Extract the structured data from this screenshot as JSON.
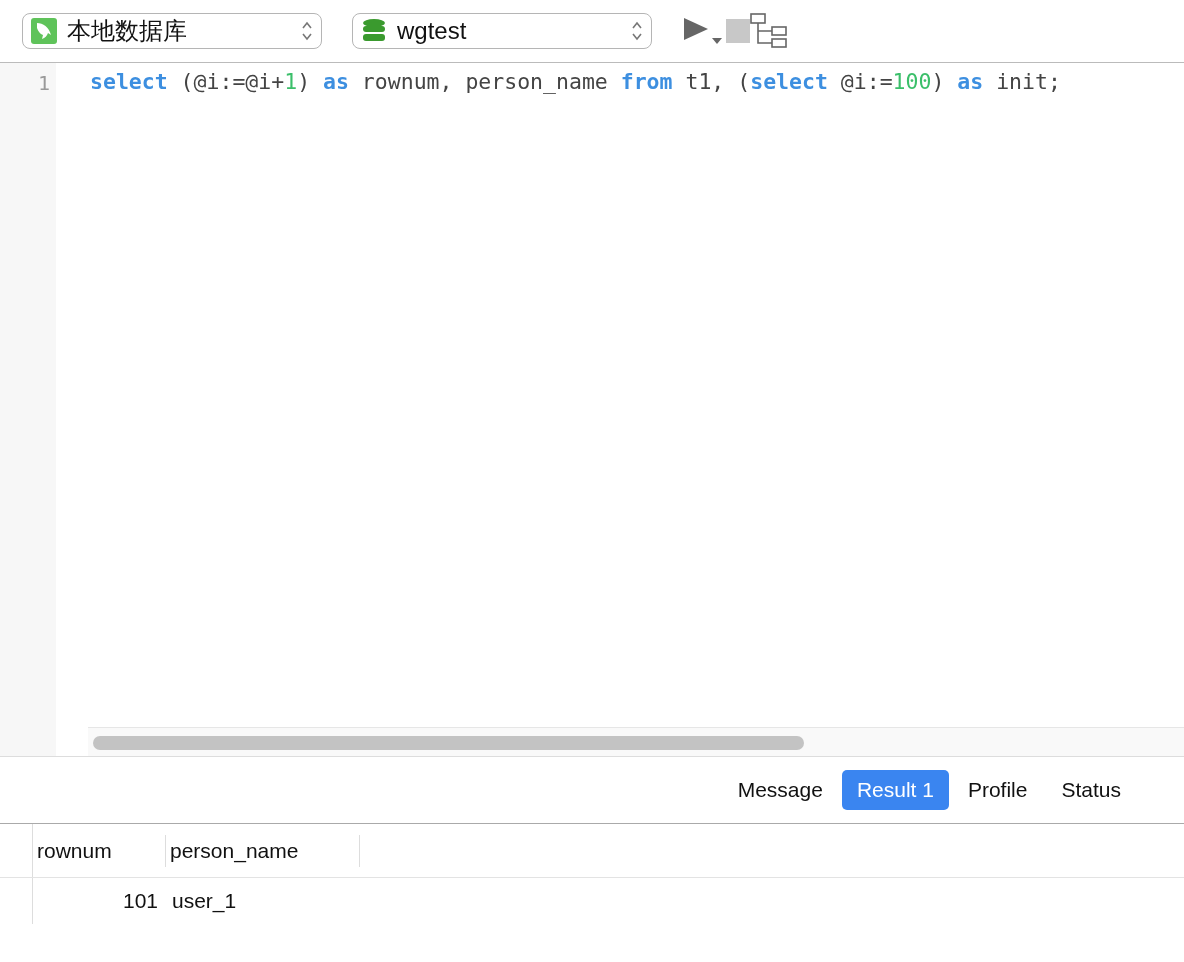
{
  "toolbar": {
    "connection": "本地数据库",
    "database": "wgtest"
  },
  "editor": {
    "lines": [
      {
        "number": "1",
        "tokens": [
          {
            "kind": "keyword",
            "text": "select"
          },
          {
            "kind": "plain",
            "text": " (@i:=@i+"
          },
          {
            "kind": "number",
            "text": "1"
          },
          {
            "kind": "plain",
            "text": ") "
          },
          {
            "kind": "keyword",
            "text": "as"
          },
          {
            "kind": "plain",
            "text": " rownum, person_name "
          },
          {
            "kind": "keyword",
            "text": "from"
          },
          {
            "kind": "plain",
            "text": " t1, ("
          },
          {
            "kind": "keyword",
            "text": "select"
          },
          {
            "kind": "plain",
            "text": " @i:="
          },
          {
            "kind": "number",
            "text": "100"
          },
          {
            "kind": "plain",
            "text": ") "
          },
          {
            "kind": "keyword",
            "text": "as"
          },
          {
            "kind": "plain",
            "text": " init;"
          }
        ]
      }
    ]
  },
  "tabs": [
    {
      "label": "Message",
      "selected": false
    },
    {
      "label": "Result 1",
      "selected": true
    },
    {
      "label": "Profile",
      "selected": false
    },
    {
      "label": "Status",
      "selected": false
    }
  ],
  "table": {
    "columns": [
      "rownum",
      "person_name"
    ],
    "rows": [
      [
        "101",
        "user_1"
      ]
    ]
  }
}
